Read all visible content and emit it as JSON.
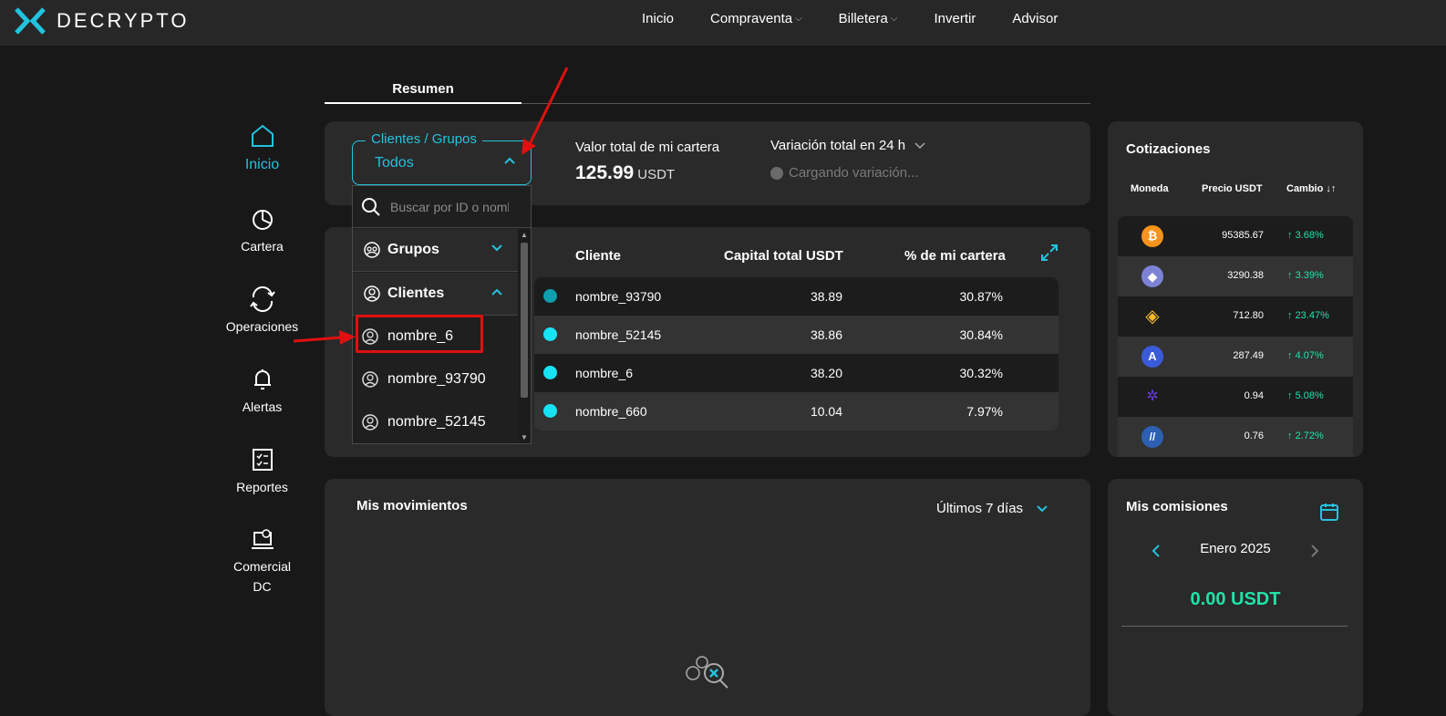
{
  "app": {
    "logo_text": "DECRYPTO"
  },
  "nav": [
    "Inicio",
    "Compraventa",
    "Billetera",
    "Invertir",
    "Advisor"
  ],
  "sidebar": [
    "Inicio",
    "Cartera",
    "Operaciones",
    "Alertas",
    "Reportes",
    "Comercial",
    "DC"
  ],
  "tabs": {
    "resumen": "Resumen"
  },
  "filter": {
    "label": "Clientes / Grupos",
    "value": "Todos",
    "search_placeholder": "Buscar por ID o nombre"
  },
  "dropdown": {
    "groups_label": "Grupos",
    "clients_label": "Clientes",
    "options": [
      "nombre_6",
      "nombre_93790",
      "nombre_52145"
    ]
  },
  "summary": {
    "total_label": "Valor total de mi cartera",
    "total_value": "125.99",
    "total_unit": "USDT",
    "variation_label": "Variación total en 24 h",
    "variation_loading": "Cargando variación..."
  },
  "clients_table": {
    "headers": [
      "Cliente",
      "Capital total USDT",
      "% de mi cartera"
    ],
    "rows": [
      {
        "name": "nombre_93790",
        "capital": "38.89",
        "pct": "30.87%",
        "color": "#0e9fb0"
      },
      {
        "name": "nombre_52145",
        "capital": "38.86",
        "pct": "30.84%",
        "color": "#17e3f5"
      },
      {
        "name": "nombre_6",
        "capital": "38.20",
        "pct": "30.32%",
        "color": "#17e3f5"
      },
      {
        "name": "nombre_660",
        "capital": "10.04",
        "pct": "7.97%",
        "color": "#17e3f5"
      }
    ]
  },
  "quotes": {
    "title": "Cotizaciones",
    "headers": [
      "Moneda",
      "Precio USDT",
      "Cambio"
    ],
    "rows": [
      {
        "coin": "bitcoin-icon",
        "price": "95385.67",
        "change": "3.68%",
        "color": "#f7931a"
      },
      {
        "coin": "ethereum-icon",
        "price": "3290.38",
        "change": "3.39%",
        "color": "#7c83d6"
      },
      {
        "coin": "bnb-icon",
        "price": "712.80",
        "change": "23.47%",
        "color": "#f3ba2f"
      },
      {
        "coin": "aave-icon",
        "price": "287.49",
        "change": "4.07%",
        "color": "#3a5bd9"
      },
      {
        "coin": "polygon-icon",
        "price": "0.94",
        "change": "5.08%",
        "color": "#6a3cd9"
      },
      {
        "coin": "arbitrum-icon",
        "price": "0.76",
        "change": "2.72%",
        "color": "#2d5fb3"
      }
    ]
  },
  "movements": {
    "title": "Mis movimientos",
    "period": "Últimos 7 días"
  },
  "commissions": {
    "title": "Mis comisiones",
    "month": "Enero 2025",
    "amount": "0.00 USDT"
  },
  "colors": {
    "accent": "#22c3de",
    "positive": "#1ee3a8",
    "highlight": "#e01010"
  }
}
